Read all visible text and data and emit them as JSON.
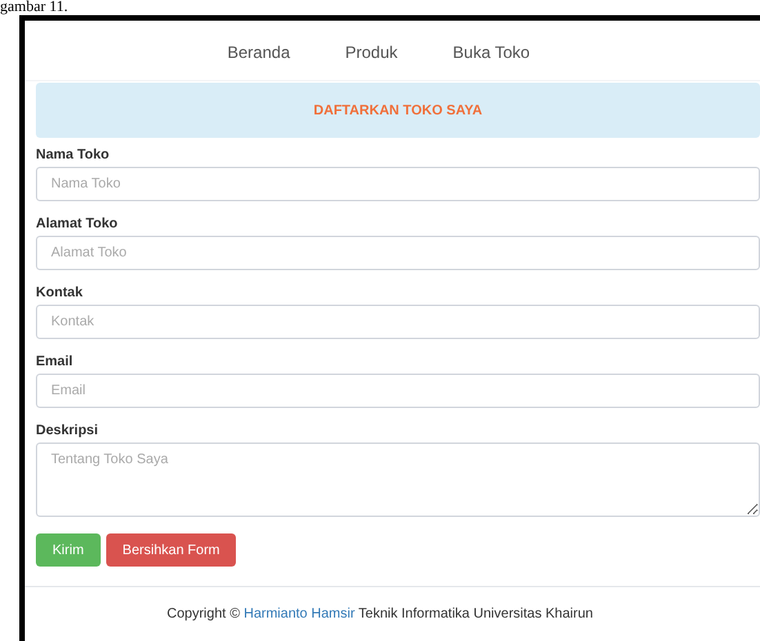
{
  "caption": "gambar 11.",
  "nav": [
    {
      "label": "Beranda"
    },
    {
      "label": "Produk"
    },
    {
      "label": "Buka Toko"
    }
  ],
  "panel_title": "DAFTARKAN TOKO SAYA",
  "fields": [
    {
      "kind": "input",
      "label": "Nama Toko",
      "placeholder": "Nama Toko"
    },
    {
      "kind": "input",
      "label": "Alamat Toko",
      "placeholder": "Alamat Toko"
    },
    {
      "kind": "input",
      "label": "Kontak",
      "placeholder": "Kontak"
    },
    {
      "kind": "input",
      "label": "Email",
      "placeholder": "Email"
    },
    {
      "kind": "textarea",
      "label": "Deskripsi",
      "placeholder": "Tentang Toko Saya"
    }
  ],
  "buttons": [
    {
      "kind": "success",
      "label": "Kirim"
    },
    {
      "kind": "danger",
      "label": "Bersihkan Form"
    }
  ],
  "footer": {
    "before": "Copyright ©",
    "link": "Harmianto Hamsir",
    "after": "Teknik Informatika Universitas Khairun"
  }
}
